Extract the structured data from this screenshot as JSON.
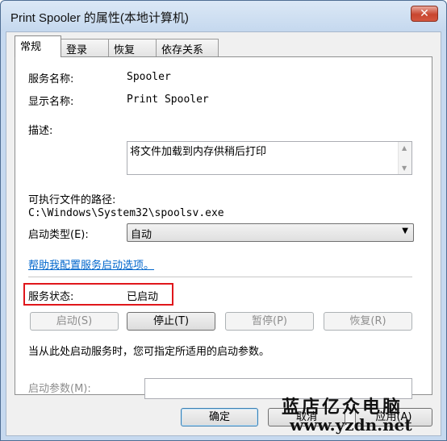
{
  "window": {
    "title": "Print Spooler 的属性(本地计算机)",
    "close_label": "✕"
  },
  "tabs": [
    {
      "label": "常规"
    },
    {
      "label": "登录"
    },
    {
      "label": "恢复"
    },
    {
      "label": "依存关系"
    }
  ],
  "general": {
    "service_name_label": "服务名称:",
    "service_name_value": "Spooler",
    "display_name_label": "显示名称:",
    "display_name_value": "Print Spooler",
    "description_label": "描述:",
    "description_value": "将文件加载到内存供稍后打印",
    "exe_path_label": "可执行文件的路径:",
    "exe_path_value": "C:\\Windows\\System32\\spoolsv.exe",
    "startup_type_label": "启动类型(E):",
    "startup_type_value": "自动",
    "help_link": "帮助我配置服务启动选项。",
    "status_label": "服务状态:",
    "status_value": "已启动",
    "start_button": "启动(S)",
    "stop_button": "停止(T)",
    "pause_button": "暂停(P)",
    "resume_button": "恢复(R)",
    "hint_text": "当从此处启动服务时，您可指定所适用的启动参数。",
    "start_params_label": "启动参数(M):",
    "start_params_value": ""
  },
  "footer": {
    "ok_button": "确定",
    "cancel_button": "取消",
    "apply_button": "应用(A)"
  },
  "watermark": {
    "line1": "蓝店亿众电脑",
    "line2": "www.yzdn.net"
  },
  "colors": {
    "highlight_border": "#e0161b",
    "link": "#0066cc"
  }
}
